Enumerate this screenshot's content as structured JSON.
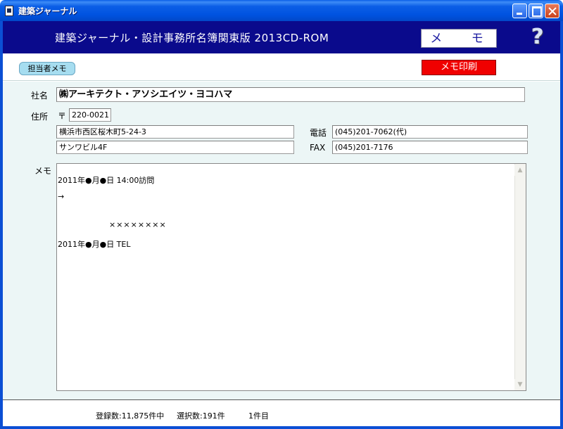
{
  "window": {
    "title": "建築ジャーナル"
  },
  "header": {
    "app_title": "建築ジャーナル・設計事務所名簿関東版 2013CD-ROM",
    "memo_button": "メ モ",
    "help_icon": "?"
  },
  "toolbar": {
    "tanto_memo_button": "担当者メモ",
    "print_button": "メモ印刷"
  },
  "form": {
    "company_label": "社名",
    "company_value": "㈱アーキテクト・アソシエイツ・ヨコハマ",
    "address_label": "住所",
    "zip_mark": "〒",
    "zip_value": "220-0021",
    "address_line1": "横浜市西区桜木町5-24-3",
    "address_line2": "サンワビル4F",
    "tel_label": "電話",
    "tel_value": "(045)201-7062(代)",
    "fax_label": "FAX",
    "fax_value": "(045)201-7176",
    "memo_label": "メモ"
  },
  "memo": {
    "lines": [
      "2011年●月●日 14:00訪問",
      "→",
      "××××××××",
      "2011年●月●日 TEL"
    ]
  },
  "status": {
    "registered": "登録数:11,875件中",
    "selected": "選択数:191件",
    "current": "1件目"
  },
  "colors": {
    "header_bg": "#0a0a8c",
    "main_bg": "#ecf6f6",
    "print_button_bg": "#f00000",
    "tanto_button_bg": "#a6ddf0"
  }
}
